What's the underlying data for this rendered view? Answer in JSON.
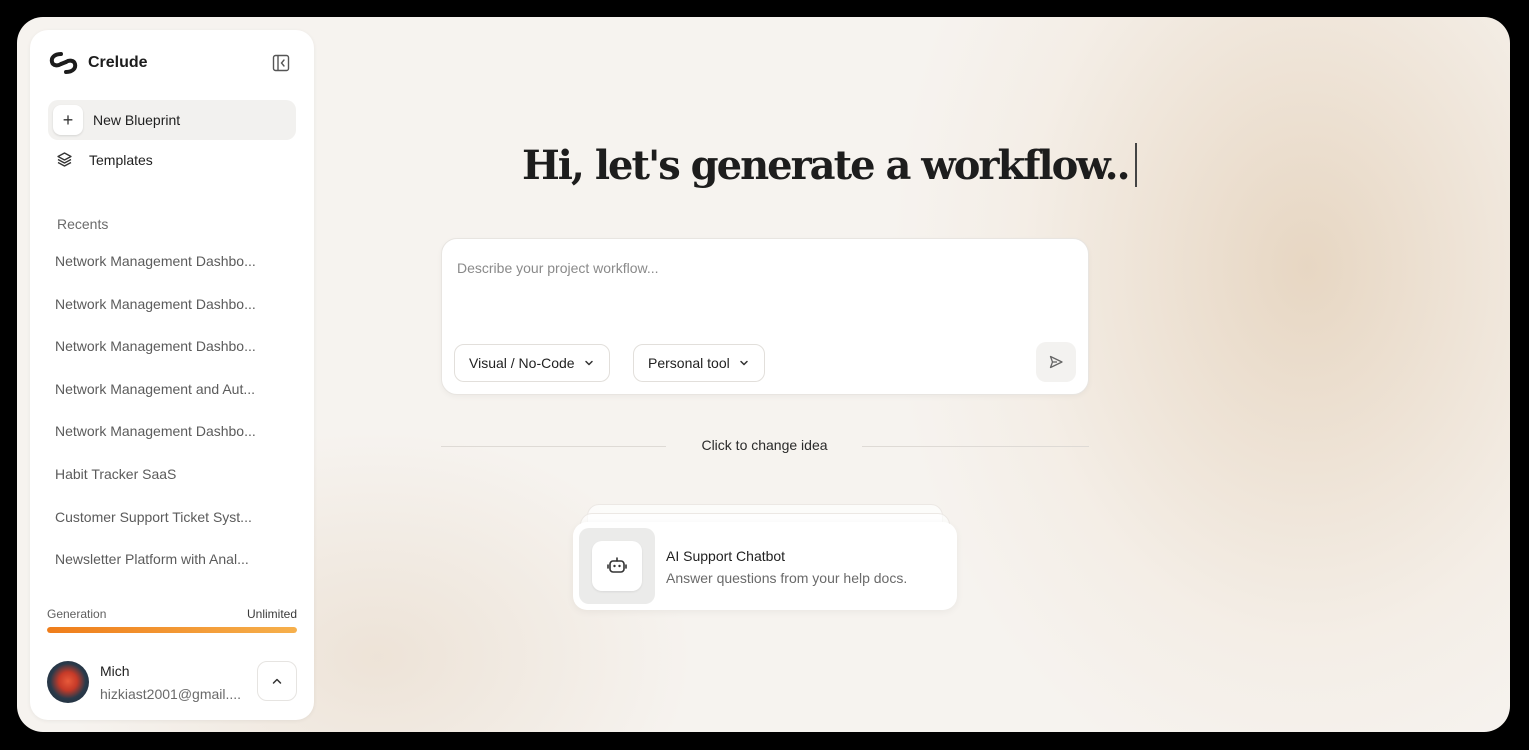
{
  "app": {
    "name": "Crelude"
  },
  "sidebar": {
    "new_blueprint_label": "New Blueprint",
    "templates_label": "Templates",
    "recents_title": "Recents",
    "recents": [
      "Network Management Dashbo...",
      "Network Management Dashbo...",
      "Network Management Dashbo...",
      "Network Management and Aut...",
      "Network Management Dashbo...",
      "Habit Tracker SaaS",
      "Customer Support Ticket Syst...",
      "Newsletter Platform with Anal..."
    ],
    "generation": {
      "label": "Generation",
      "value": "Unlimited",
      "progress": 1.0
    },
    "user": {
      "name": "Mich",
      "email": "hizkiast2001@gmail...."
    }
  },
  "main": {
    "headline": "Hi, let's generate a workflow..",
    "prompt_placeholder": "Describe your project workflow...",
    "prompt_value": "",
    "options": [
      "Visual / No-Code",
      "Personal tool"
    ],
    "change_idea_label": "Click to change idea",
    "idea_card": {
      "title": "AI Support Chatbot",
      "description": "Answer questions from your help docs.",
      "icon": "robot-icon"
    }
  },
  "colors": {
    "accent_start": "#ef7d1a",
    "accent_end": "#f6b04c",
    "background": "#f6f3ef"
  }
}
